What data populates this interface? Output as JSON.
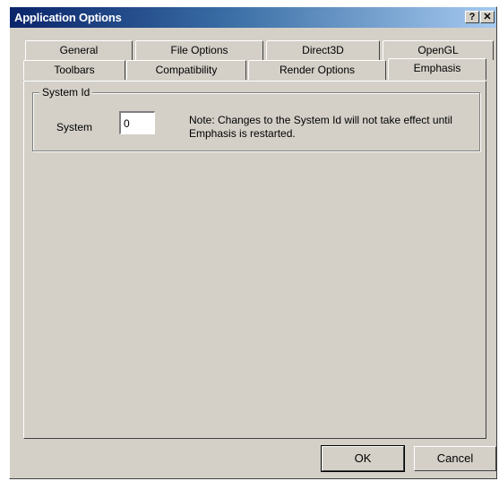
{
  "window": {
    "title": "Application Options",
    "help_glyph": "?",
    "close_glyph": "✕"
  },
  "tabs": {
    "back_row": [
      "General",
      "File Options",
      "Direct3D",
      "OpenGL"
    ],
    "front_row": [
      "Toolbars",
      "Compatibility",
      "Render Options",
      "Emphasis"
    ],
    "active": "Emphasis"
  },
  "group": {
    "label": "System Id",
    "field_label": "System",
    "field_value": "0",
    "note": "Note:  Changes to the System Id will not take effect until Emphasis is restarted."
  },
  "buttons": {
    "ok": "OK",
    "cancel": "Cancel"
  }
}
